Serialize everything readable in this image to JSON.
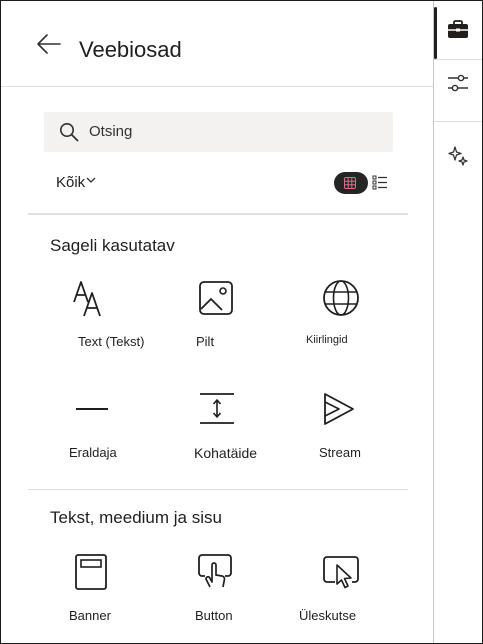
{
  "panel": {
    "title": "Veebiosad",
    "search": {
      "placeholder": "Otsing",
      "value": ""
    },
    "filter": {
      "label": "Kõik"
    },
    "view": {
      "selected": "grid"
    }
  },
  "sections": [
    {
      "title": "Sageli kasutatav",
      "tiles": [
        {
          "label": "Text (Tekst)",
          "icon": "text-icon"
        },
        {
          "label": "Pilt",
          "icon": "image-icon"
        },
        {
          "label": "Kiirlingid",
          "icon": "globe-icon"
        },
        {
          "label": "Eraldaja",
          "icon": "divider-icon"
        },
        {
          "label": "Kohatäide",
          "icon": "spacer-icon"
        },
        {
          "label": "Stream",
          "icon": "stream-icon"
        }
      ]
    },
    {
      "title": "Tekst, meedium ja sisu",
      "tiles": [
        {
          "label": "Banner",
          "icon": "banner-icon"
        },
        {
          "label": "Button",
          "icon": "button-icon"
        },
        {
          "label": "Üleskutse",
          "icon": "call-to-action-icon"
        }
      ]
    }
  ],
  "rail": {
    "items": [
      {
        "icon": "toolbox-icon",
        "selected": true
      },
      {
        "icon": "sliders-icon",
        "selected": false
      },
      {
        "icon": "sparkle-icon",
        "selected": false
      }
    ]
  },
  "colors": {
    "accent": "#252526",
    "divider": "#e1dfdd",
    "search_bg": "#f3f2f1"
  }
}
